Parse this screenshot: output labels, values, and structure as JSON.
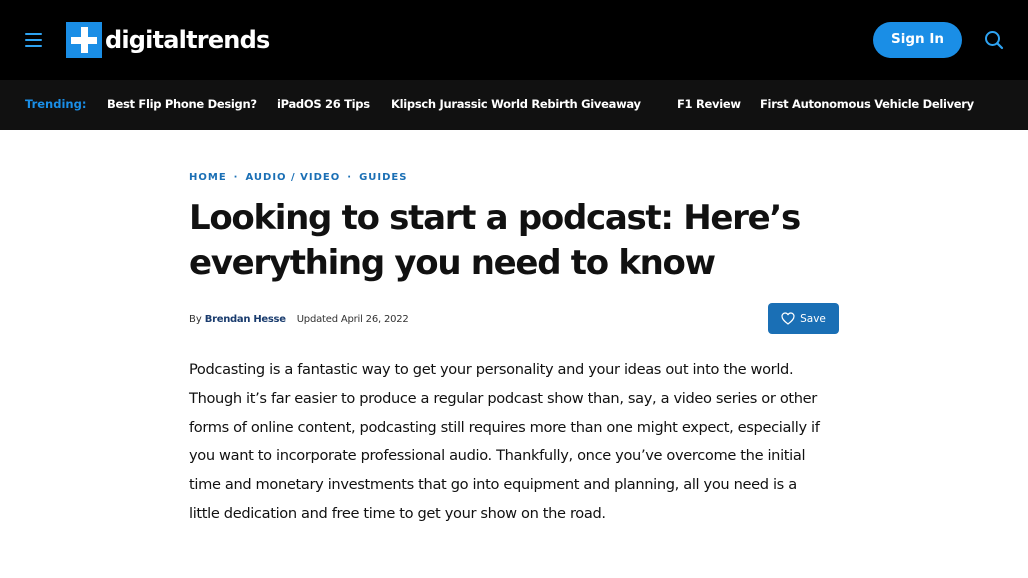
{
  "header": {
    "menu_icon": "hamburger-icon",
    "logo_text": "digitaltrends",
    "sign_in_label": "Sign In",
    "search_icon": "search-icon",
    "accent_color": "#1a8ee6"
  },
  "trending": {
    "label": "Trending:",
    "links": [
      "Best Flip Phone Design?",
      "iPadOS 26 Tips",
      "Klipsch Jurassic World Rebirth Giveaway",
      "F1 Review",
      "First Autonomous Vehicle Delivery"
    ]
  },
  "breadcrumb": {
    "items": [
      "HOME",
      "AUDIO / VIDEO",
      "GUIDES"
    ],
    "separator": "·"
  },
  "article": {
    "title": "Looking to start a podcast: Here’s everything you need to know",
    "by_prefix": "By",
    "author": "Brendan Hesse",
    "updated": "Updated April 26, 2022",
    "save_label": "Save",
    "save_icon": "heart-icon",
    "body": "Podcasting is a fantastic way to get your personality and your ideas out into the world. Though it’s far easier to produce a regular podcast show than, say, a video series or other forms of online content, podcasting still requires more than one might expect, especially if you want to incorporate professional audio. Thankfully, once you’ve overcome the initial time and monetary investments that go into equipment and planning, all you need is a little dedication and free time to get your show on the road."
  }
}
